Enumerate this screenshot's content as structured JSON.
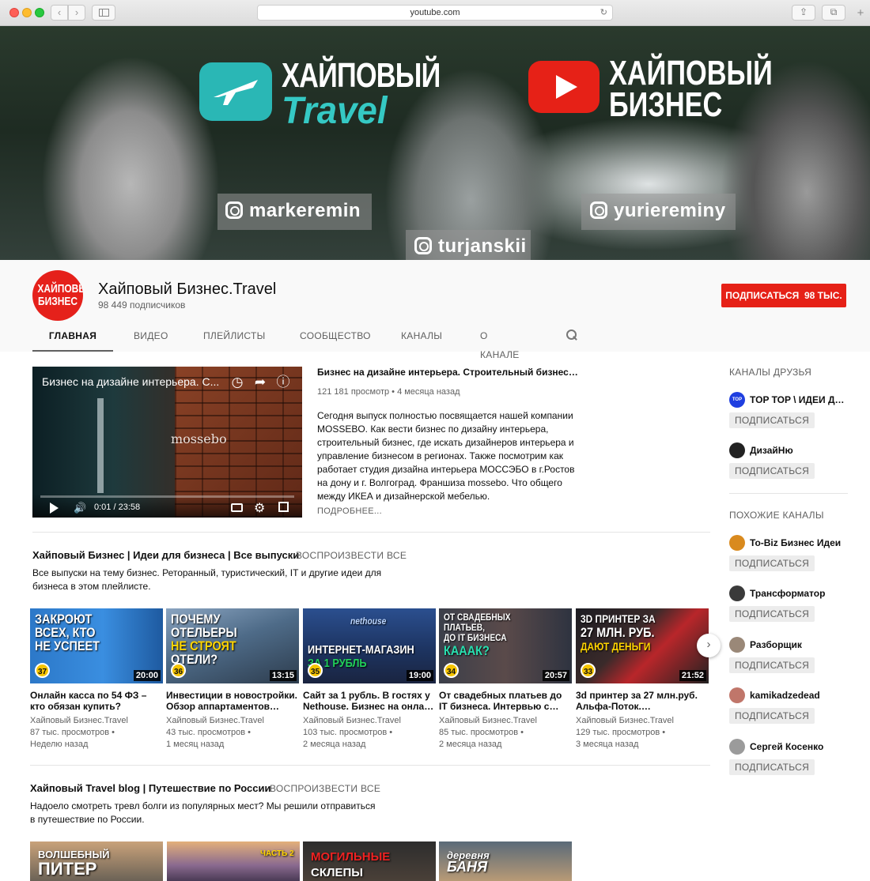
{
  "browser": {
    "url": "youtube.com",
    "back": "‹",
    "forward": "›",
    "reload": "↻",
    "share": "⇪",
    "tabs": "⧉",
    "new_tab": "+"
  },
  "banner": {
    "left_brand_line1": "ХАЙПОВЫЙ",
    "left_brand_line2": "Travel",
    "right_brand_line1": "ХАЙПОВЫЙ",
    "right_brand_line2": "БИЗНЕС",
    "instagram_left": "markeremin",
    "instagram_center": "turjanskii",
    "instagram_right": "yuriereminу"
  },
  "channel": {
    "avatar_line1": "ХАЙПОВЫЙ",
    "avatar_line2": "БИЗНЕС",
    "name": "Хайповый Бизнес.Travel",
    "subscribers": "98 449 подписчиков",
    "subscribe_label": "ПОДПИСАТЬСЯ",
    "subscribe_count": "98 ТЫС."
  },
  "tabs": [
    {
      "label": "ГЛАВНАЯ"
    },
    {
      "label": "ВИДЕО"
    },
    {
      "label": "ПЛЕЙЛИСТЫ"
    },
    {
      "label": "СООБЩЕСТВО"
    },
    {
      "label": "КАНАЛЫ"
    },
    {
      "label": "О КАНАЛЕ"
    }
  ],
  "featured": {
    "player_title": "Бизнес на дизайне интерьера. С...",
    "player_brand": "mossebo",
    "time": "0:01 / 23:58",
    "title": "Бизнес на дизайне интерьера. Строительный бизнес. Инте...",
    "meta": "121 181 просмотр • 4 месяца назад",
    "description": "Сегодня выпуск полностью посвящается нашей компании MOSSEBO. Как вести бизнес по дизайну интерьера, строительный бизнес, где искать дизайнеров интерьера и управление бизнесом в регионах. Также посмотрим как работает студия дизайна интерьера МОССЭБО в г.Ростов на дону и г. Волгоград. Франшиза mossebo. Что общего между ИКЕА и дизайнерской мебелью.",
    "more": "ПОДРОБНЕЕ..."
  },
  "shelf1": {
    "title": "Хайповый Бизнес | Идеи для бизнеса | Все выпуски",
    "play_all": "ВОСПРОИЗВЕСТИ ВСЕ",
    "description": "Все выпуски на тему бизнес. Реторанный, туристический, IT и другие идеи для бизнеса в этом плейлисте.",
    "videos": [
      {
        "thumb_line1": "ЗАКРОЮТ",
        "thumb_line2": "ВСЕХ, КТО",
        "thumb_line3": "НЕ УСПЕЕТ",
        "number": "37",
        "duration": "20:00",
        "title": "Онлайн касса по 54 ФЗ – кто обязан купить?",
        "channel": "Хайповый Бизнес.Travel",
        "views": "87 тыс. просмотров •",
        "age": "Неделю назад"
      },
      {
        "thumb_line1": "ПОЧЕМУ ОТЕЛЬЕРЫ",
        "thumb_line2": "НЕ СТРОЯТ",
        "thumb_line3": "ОТЕЛИ?",
        "number": "36",
        "duration": "13:15",
        "title": "Инвестиции в новостройки. Обзор аппартаментов…",
        "channel": "Хайповый Бизнес.Travel",
        "views": "43 тыс. просмотров •",
        "age": "1 месяц назад"
      },
      {
        "thumb_line1": "nethouse",
        "thumb_line2": "ИНТЕРНЕТ-МАГАЗИН",
        "thumb_line3": "ЗА 1 РУБЛЬ",
        "number": "35",
        "duration": "19:00",
        "title": "Сайт за 1 рубль. В гостях у Nethouse. Бизнес на онла…",
        "channel": "Хайповый Бизнес.Travel",
        "views": "103 тыс. просмотров •",
        "age": "2 месяца назад"
      },
      {
        "thumb_line1": "ОТ СВАДЕБНЫХ ПЛАТЬЕВ,",
        "thumb_line2": "ДО IT БИЗНЕСА",
        "thumb_line3": "КАААК?",
        "number": "34",
        "duration": "20:57",
        "title": "От свадебных платьев до IT бизнеса. Интервью с…",
        "channel": "Хайповый Бизнес.Travel",
        "views": "85 тыс. просмотров •",
        "age": "2 месяца назад"
      },
      {
        "thumb_line1": "3D ПРИНТЕР ЗА",
        "thumb_line2": "27 МЛН. РУБ.",
        "thumb_line3": "ДАЮТ ДЕНЬГИ",
        "number": "33",
        "duration": "21:52",
        "title": "3d принтер за 27 млн.руб. Альфа-Поток.…",
        "channel": "Хайповый Бизнес.Travel",
        "views": "129 тыс. просмотров •",
        "age": "3 месяца назад"
      }
    ],
    "next": "›"
  },
  "shelf2": {
    "title": "Хайповый Travel blog | Путешествие по России",
    "play_all": "ВОСПРОИЗВЕСТИ ВСЕ",
    "description": "Надоело смотреть тревл болги из популярных мест? Мы решили отправиться в путешествие по России.",
    "thumbs": [
      {
        "line1": "ВОЛШЕБНЫЙ",
        "line2": "ПИТЕР"
      },
      {
        "line1": "ЧАСТЬ 2",
        "line2": ""
      },
      {
        "line1": "МОГИЛЬНЫЕ",
        "line2": "СКЛЕПЫ"
      },
      {
        "line1": "деревня",
        "line2": "БАНЯ"
      }
    ]
  },
  "sidebar": {
    "friends_header": "КАНАЛЫ ДРУЗЬЯ",
    "similar_header": "ПОХОЖИЕ КАНАЛЫ",
    "subscribe_label": "ПОДПИСАТЬСЯ",
    "friends": [
      {
        "name": "TOP TOP \\ ИДЕИ ДЛЯ …",
        "avatar_text": "TOP TOP",
        "color": "#1f3fe0"
      },
      {
        "name": "ДизайНю",
        "avatar_text": "",
        "color": "#222222"
      }
    ],
    "similar": [
      {
        "name": "To-Biz Бизнес Идеи",
        "avatar_text": "",
        "color": "#d98a1e"
      },
      {
        "name": "Трансформатор",
        "avatar_text": "",
        "color": "#3a3a3a"
      },
      {
        "name": "Разборщик",
        "avatar_text": "",
        "color": "#9a8878"
      },
      {
        "name": "kamikadzedead",
        "avatar_text": "",
        "color": "#c0766a"
      },
      {
        "name": "Сергей Косенко",
        "avatar_text": "",
        "color": "#9b9b9b"
      }
    ]
  },
  "colors": {
    "accent_red": "#e62117",
    "travel_teal": "#2ab7b5",
    "badge_yellow": "#f5c400"
  }
}
